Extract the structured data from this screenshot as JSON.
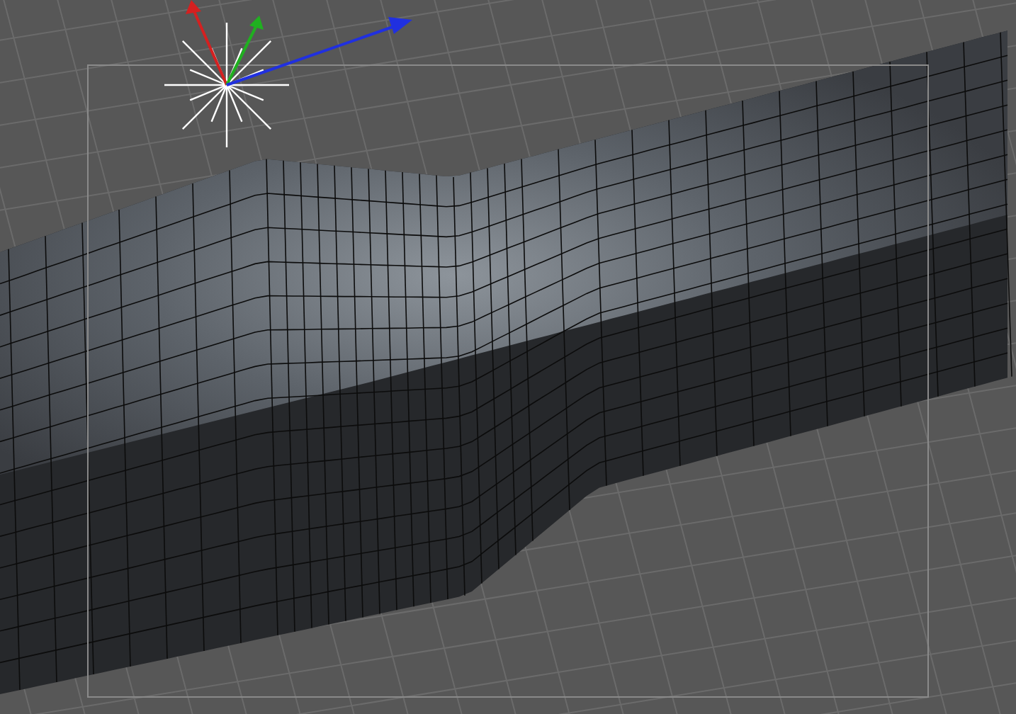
{
  "viewport": {
    "kind": "perspective",
    "safe_frame": true
  }
}
